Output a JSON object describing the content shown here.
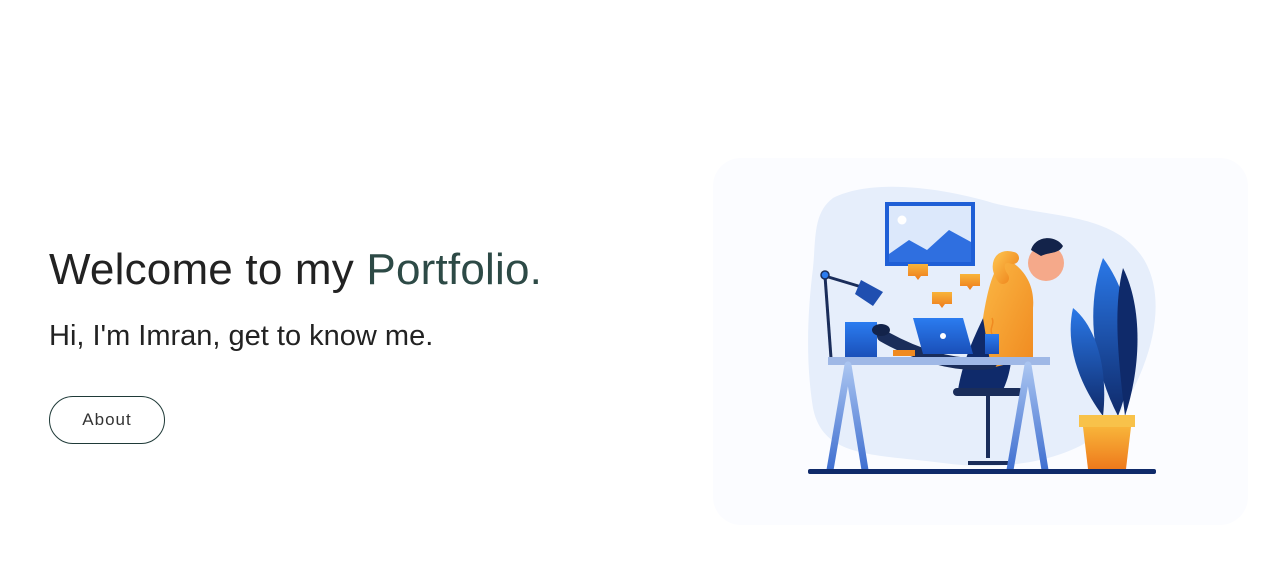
{
  "hero": {
    "welcome_prefix": "Welcome to my ",
    "welcome_accent": "Portfolio.",
    "tagline": "Hi, I'm Imran, get to know me.",
    "about_label": "About"
  },
  "colors": {
    "accent": "#2d4a46",
    "text": "#222222",
    "button_border": "#1f3a38",
    "illustration_blue": "#1f6fe0",
    "illustration_orange": "#f7a02a"
  },
  "illustration": {
    "icon": "workspace-illustration"
  }
}
